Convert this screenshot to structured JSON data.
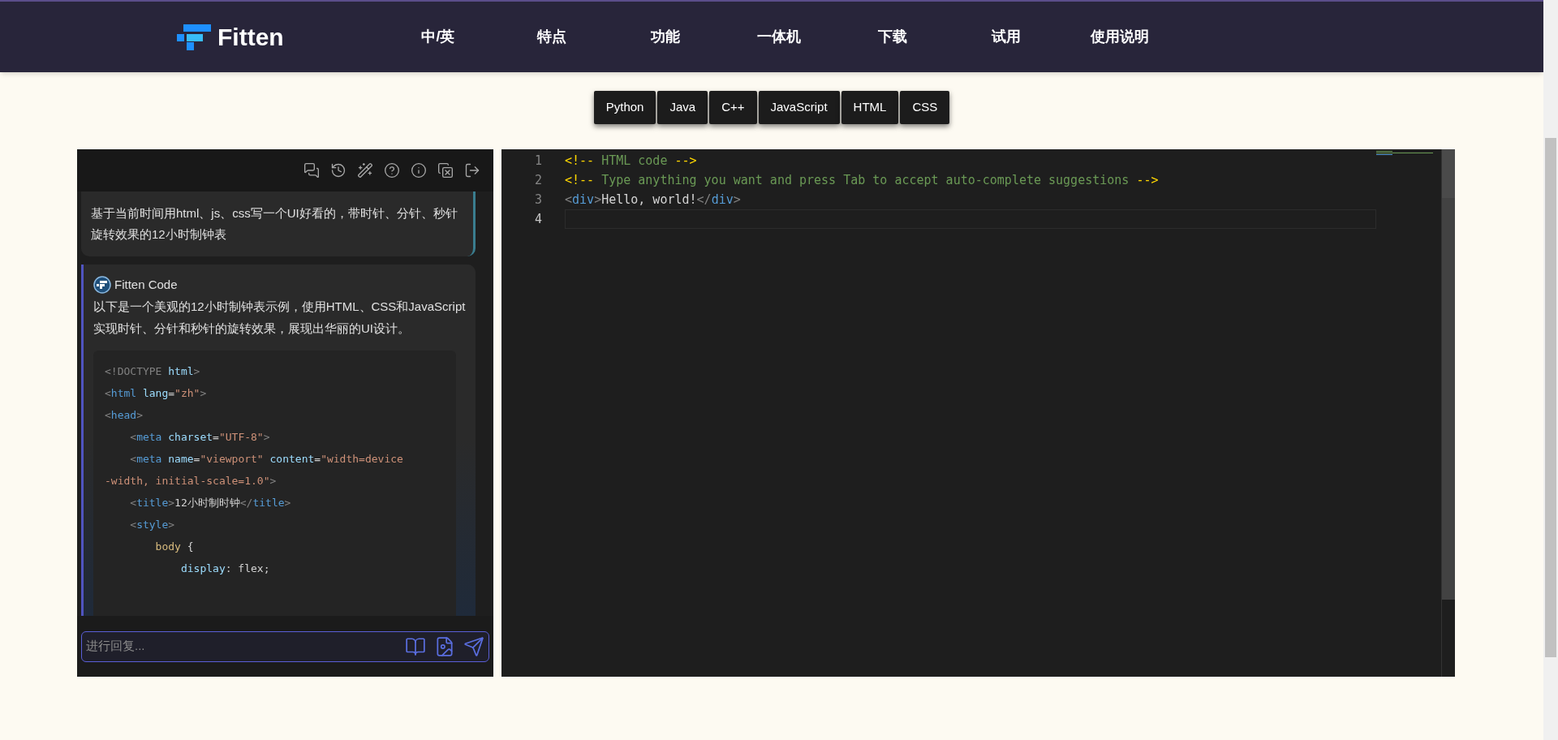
{
  "header": {
    "logo": "Fitten",
    "nav": [
      "中/英",
      "特点",
      "功能",
      "一体机",
      "下载",
      "试用",
      "使用说明"
    ]
  },
  "languages": [
    "Python",
    "Java",
    "C++",
    "JavaScript",
    "HTML",
    "CSS"
  ],
  "chat": {
    "messages": [
      {
        "kind": "user",
        "text": "基于当前时间用html、js、css写一个UI好看的，带时针、分针、秒针旋转效果的12小时制钟表"
      },
      {
        "kind": "assistant",
        "author": "Fitten Code",
        "text": "以下是一个美观的12小时制钟表示例，使用HTML、CSS和JavaScript实现时针、分针和秒针的旋转效果，展现出华丽的UI设计。",
        "code": [
          [
            {
              "kind": "punct",
              "text": "<!DOCTYPE "
            },
            {
              "kind": "attr",
              "text": "html"
            },
            {
              "kind": "punct",
              "text": ">"
            }
          ],
          [
            {
              "kind": "punct",
              "text": "<"
            },
            {
              "kind": "tag",
              "text": "html "
            },
            {
              "kind": "attr",
              "text": "lang"
            },
            {
              "kind": "plain",
              "text": "="
            },
            {
              "kind": "string",
              "text": "\"zh\""
            },
            {
              "kind": "punct",
              "text": ">"
            }
          ],
          [
            {
              "kind": "punct",
              "text": "<"
            },
            {
              "kind": "tag",
              "text": "head"
            },
            {
              "kind": "punct",
              "text": ">"
            }
          ],
          [
            {
              "kind": "punct",
              "text": "    <"
            },
            {
              "kind": "tag",
              "text": "meta "
            },
            {
              "kind": "attr",
              "text": "charset"
            },
            {
              "kind": "plain",
              "text": "="
            },
            {
              "kind": "string",
              "text": "\"UTF-8\""
            },
            {
              "kind": "punct",
              "text": ">"
            }
          ],
          [
            {
              "kind": "punct",
              "text": "    <"
            },
            {
              "kind": "tag",
              "text": "meta "
            },
            {
              "kind": "attr",
              "text": "name"
            },
            {
              "kind": "plain",
              "text": "="
            },
            {
              "kind": "string",
              "text": "\"viewport\" "
            },
            {
              "kind": "attr",
              "text": "content"
            },
            {
              "kind": "plain",
              "text": "="
            },
            {
              "kind": "string",
              "text": "\"width=device"
            }
          ],
          [
            {
              "kind": "string",
              "text": "-width, initial-scale=1.0\""
            },
            {
              "kind": "punct",
              "text": ">"
            }
          ],
          [
            {
              "kind": "punct",
              "text": "    <"
            },
            {
              "kind": "tag",
              "text": "title"
            },
            {
              "kind": "punct",
              "text": ">"
            },
            {
              "kind": "plain",
              "text": "12小时制时钟"
            },
            {
              "kind": "punct",
              "text": "</"
            },
            {
              "kind": "tag",
              "text": "title"
            },
            {
              "kind": "punct",
              "text": ">"
            }
          ],
          [
            {
              "kind": "punct",
              "text": "    <"
            },
            {
              "kind": "tag",
              "text": "style"
            },
            {
              "kind": "punct",
              "text": ">"
            }
          ],
          [
            {
              "kind": "selector",
              "text": "        body "
            },
            {
              "kind": "plain",
              "text": "{"
            }
          ],
          [
            {
              "kind": "attr",
              "text": "            display"
            },
            {
              "kind": "plain",
              "text": ": flex;"
            }
          ]
        ]
      }
    ],
    "input": {
      "placeholder": "进行回复..."
    }
  },
  "editor": {
    "lines": [
      {
        "number": "1",
        "current": false,
        "tokens": [
          {
            "kind": "delim",
            "text": "<!--"
          },
          {
            "kind": "comment",
            "text": " HTML code "
          },
          {
            "kind": "delim",
            "text": "-->"
          }
        ]
      },
      {
        "number": "2",
        "current": false,
        "tokens": [
          {
            "kind": "delim",
            "text": "<!--"
          },
          {
            "kind": "comment",
            "text": " Type anything you want and press Tab to accept auto-complete suggestions "
          },
          {
            "kind": "delim",
            "text": "-->"
          }
        ]
      },
      {
        "number": "3",
        "current": false,
        "tokens": [
          {
            "kind": "punct",
            "text": "<"
          },
          {
            "kind": "tag",
            "text": "div"
          },
          {
            "kind": "punct",
            "text": ">"
          },
          {
            "kind": "plain",
            "text": "Hello, world!"
          },
          {
            "kind": "punct",
            "text": "</"
          },
          {
            "kind": "tag",
            "text": "div"
          },
          {
            "kind": "punct",
            "text": ">"
          }
        ]
      },
      {
        "number": "4",
        "current": true
      }
    ]
  }
}
